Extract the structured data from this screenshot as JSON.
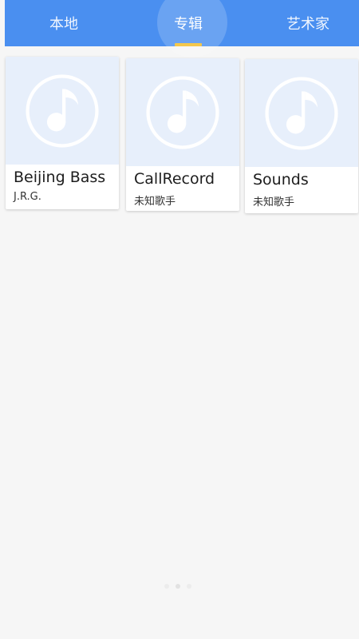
{
  "tabs": [
    {
      "label": "本地"
    },
    {
      "label": "专辑"
    },
    {
      "label": "艺术家"
    }
  ],
  "active_tab": "专辑",
  "albums": [
    {
      "title": "Beijing Bass",
      "artist": "J.R.G."
    },
    {
      "title": "CallRecord",
      "artist": "未知歌手"
    },
    {
      "title": "Sounds",
      "artist": "未知歌手"
    }
  ],
  "cover_icon": "music-note-icon",
  "colors": {
    "accent": "#4a8ff0",
    "indicator": "#f3c74c",
    "background": "#f6f6f6",
    "cover_bg": "#e7effb"
  },
  "pager": {
    "active_index": 1,
    "count": 3
  }
}
